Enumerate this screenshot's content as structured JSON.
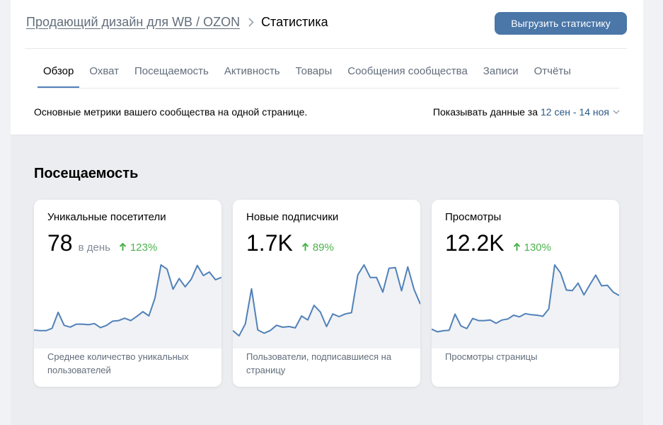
{
  "breadcrumb": {
    "community": "Продающий дизайн для WB / OZON",
    "current": "Статистика"
  },
  "header": {
    "export_label": "Выгрузить статистику"
  },
  "tabs": [
    {
      "label": "Обзор"
    },
    {
      "label": "Охват"
    },
    {
      "label": "Посещаемость"
    },
    {
      "label": "Активность"
    },
    {
      "label": "Товары"
    },
    {
      "label": "Сообщения сообщества"
    },
    {
      "label": "Записи"
    },
    {
      "label": "Отчёты"
    }
  ],
  "overview": {
    "description": "Основные метрики вашего сообщества на одной странице.",
    "period_label": "Показывать данные за",
    "period_value": "12 сен - 14 ноя"
  },
  "section": {
    "title": "Посещаемость"
  },
  "colors": {
    "accent": "#4a76a8",
    "trend_up": "#4bb34b",
    "sparkline": "#5181b8",
    "sparkline_fill": "#f0f2f5"
  },
  "cards": [
    {
      "title": "Уникальные посетители",
      "value": "78",
      "unit": "в день",
      "trend": "123%",
      "subtitle": "Среднее количество уникальных пользователей",
      "series": [
        12,
        11,
        11,
        15,
        42,
        20,
        17,
        22,
        22,
        21,
        23,
        16,
        20,
        27,
        28,
        32,
        28,
        35,
        43,
        36,
        66,
        122,
        115,
        81,
        99,
        85,
        98,
        121,
        104,
        110,
        97,
        101
      ]
    },
    {
      "title": "Новые подписчики",
      "value": "1.7K",
      "unit": "",
      "trend": "89%",
      "subtitle": "Пользователи, подписавшиеся на страницу",
      "series": [
        10,
        2,
        20,
        73,
        11,
        6,
        10,
        18,
        15,
        16,
        14,
        32,
        26,
        48,
        38,
        16,
        35,
        31,
        35,
        37,
        94,
        109,
        90,
        90,
        68,
        104,
        105,
        70,
        106,
        72,
        50
      ]
    },
    {
      "title": "Просмотры",
      "value": "12.2K",
      "unit": "",
      "trend": "130%",
      "subtitle": "Просмотры страницы",
      "series": [
        15,
        10,
        12,
        13,
        43,
        21,
        16,
        35,
        31,
        31,
        32,
        26,
        32,
        34,
        41,
        38,
        44,
        42,
        41,
        39,
        53,
        135,
        120,
        88,
        87,
        101,
        79,
        98,
        116,
        96,
        97,
        84,
        78
      ]
    }
  ]
}
